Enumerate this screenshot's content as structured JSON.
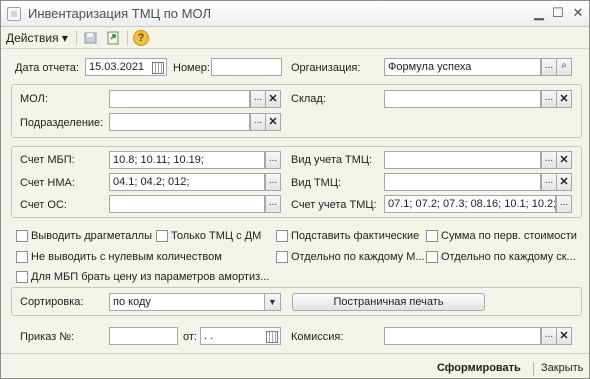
{
  "window": {
    "title": "Инвентаризация ТМЦ по МОЛ"
  },
  "toolbar": {
    "actions_label": "Действия",
    "help_label": "?"
  },
  "header": {
    "date_label": "Дата отчета:",
    "date_value": "15.03.2021",
    "number_label": "Номер:",
    "number_value": "",
    "org_label": "Организация:",
    "org_value": "Формула успеха"
  },
  "group1": {
    "mol_label": "МОЛ:",
    "mol_value": "",
    "warehouse_label": "Склад:",
    "warehouse_value": "",
    "division_label": "Подразделение:",
    "division_value": ""
  },
  "group2": {
    "mbp_label": "Счет МБП:",
    "mbp_value": "10.8; 10.11; 10.19;",
    "nma_label": "Счет НМА:",
    "nma_value": "04.1; 04.2; 012;",
    "os_label": "Счет ОС:",
    "os_value": "",
    "vid_ucheta_label": "Вид учета ТМЦ:",
    "vid_ucheta_value": "",
    "vid_tmc_label": "Вид ТМЦ:",
    "vid_tmc_value": "",
    "schet_ucheta_label": "Счет учета ТМЦ:",
    "schet_ucheta_value": "07.1; 07.2; 07.3; 08.16; 10.1; 10.2;"
  },
  "checkboxes": {
    "c1": "Выводить драгметаллы",
    "c2": "Только ТМЦ с ДМ",
    "c3": "Подставить фактические",
    "c4": "Сумма по перв. стоимости",
    "c5": "Не выводить с нулевым количеством",
    "c6": "Отдельно по каждому М...",
    "c7": "Отдельно по каждому ск...",
    "c8": "Для МБП брать цену из параметров амортиз..."
  },
  "sort": {
    "label": "Сортировка:",
    "value": "по коду",
    "print_button": "Постраничная печать"
  },
  "bottom": {
    "order_label": "Приказ №:",
    "order_value": "",
    "from_label": "от:",
    "from_value": " .  .",
    "commission_label": "Комиссия:",
    "commission_value": ""
  },
  "footer": {
    "generate": "Сформировать",
    "close": "Закрыть"
  }
}
